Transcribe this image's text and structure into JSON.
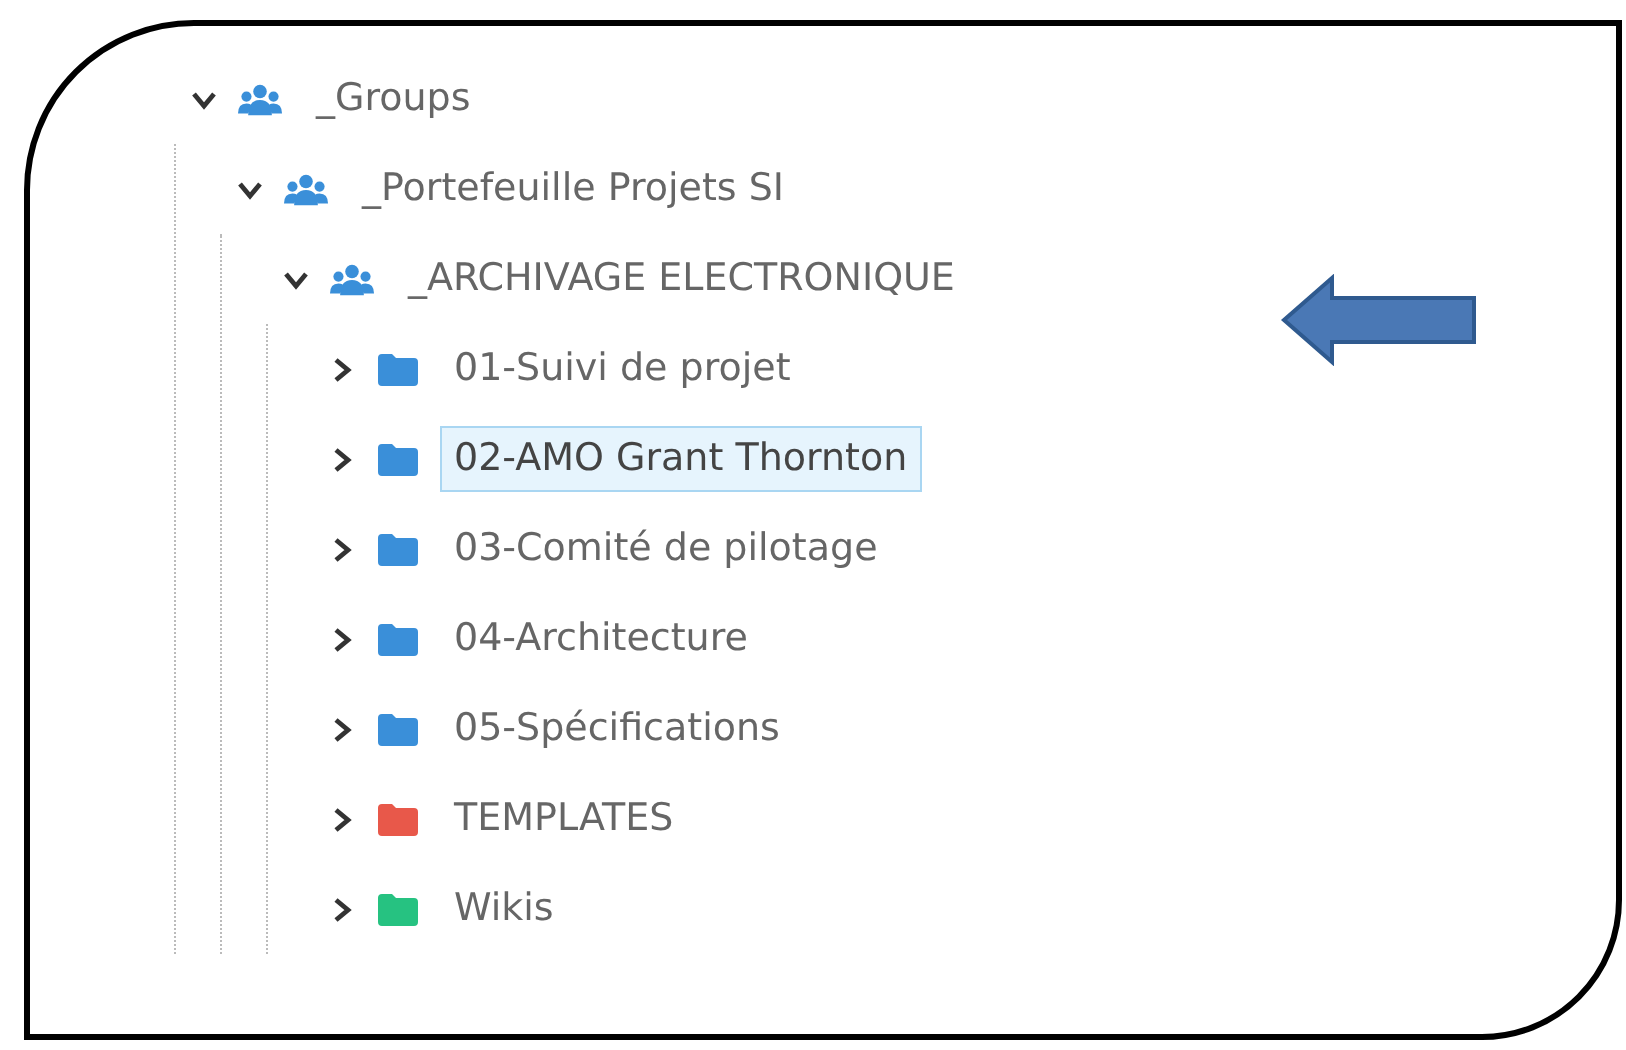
{
  "tree": [
    {
      "label": "_Groups",
      "kind": "group",
      "expanded": true,
      "selected": false,
      "children": [
        {
          "label": "_Portefeuille Projets SI",
          "kind": "group",
          "expanded": true,
          "selected": false,
          "children": [
            {
              "label": "_ARCHIVAGE ELECTRONIQUE",
              "kind": "group",
              "expanded": true,
              "selected": false,
              "children": [
                {
                  "label": "01-Suivi de projet",
                  "kind": "folder",
                  "color": "#3a8fd9",
                  "expanded": false,
                  "selected": false
                },
                {
                  "label": "02-AMO Grant Thornton",
                  "kind": "folder",
                  "color": "#3a8fd9",
                  "expanded": false,
                  "selected": true
                },
                {
                  "label": "03-Comité de pilotage",
                  "kind": "folder",
                  "color": "#3a8fd9",
                  "expanded": false,
                  "selected": false
                },
                {
                  "label": "04-Architecture",
                  "kind": "folder",
                  "color": "#3a8fd9",
                  "expanded": false,
                  "selected": false
                },
                {
                  "label": "05-Spécifications",
                  "kind": "folder",
                  "color": "#3a8fd9",
                  "expanded": false,
                  "selected": false
                },
                {
                  "label": "TEMPLATES",
                  "kind": "folder",
                  "color": "#e8584a",
                  "expanded": false,
                  "selected": false
                },
                {
                  "label": "Wikis",
                  "kind": "folder",
                  "color": "#26c281",
                  "expanded": false,
                  "selected": false
                }
              ]
            }
          ]
        }
      ]
    }
  ]
}
